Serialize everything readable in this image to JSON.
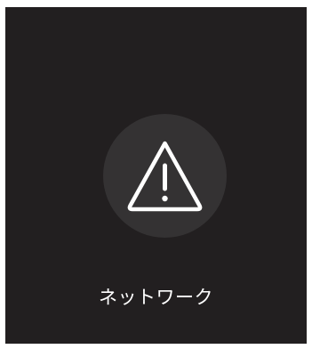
{
  "card": {
    "label": "ネットワーク",
    "icon": "warning-triangle-icon"
  },
  "colors": {
    "card_background": "#221f20",
    "icon_circle": "#343233",
    "icon_stroke": "#ffffff",
    "label_text": "#ffffff"
  }
}
